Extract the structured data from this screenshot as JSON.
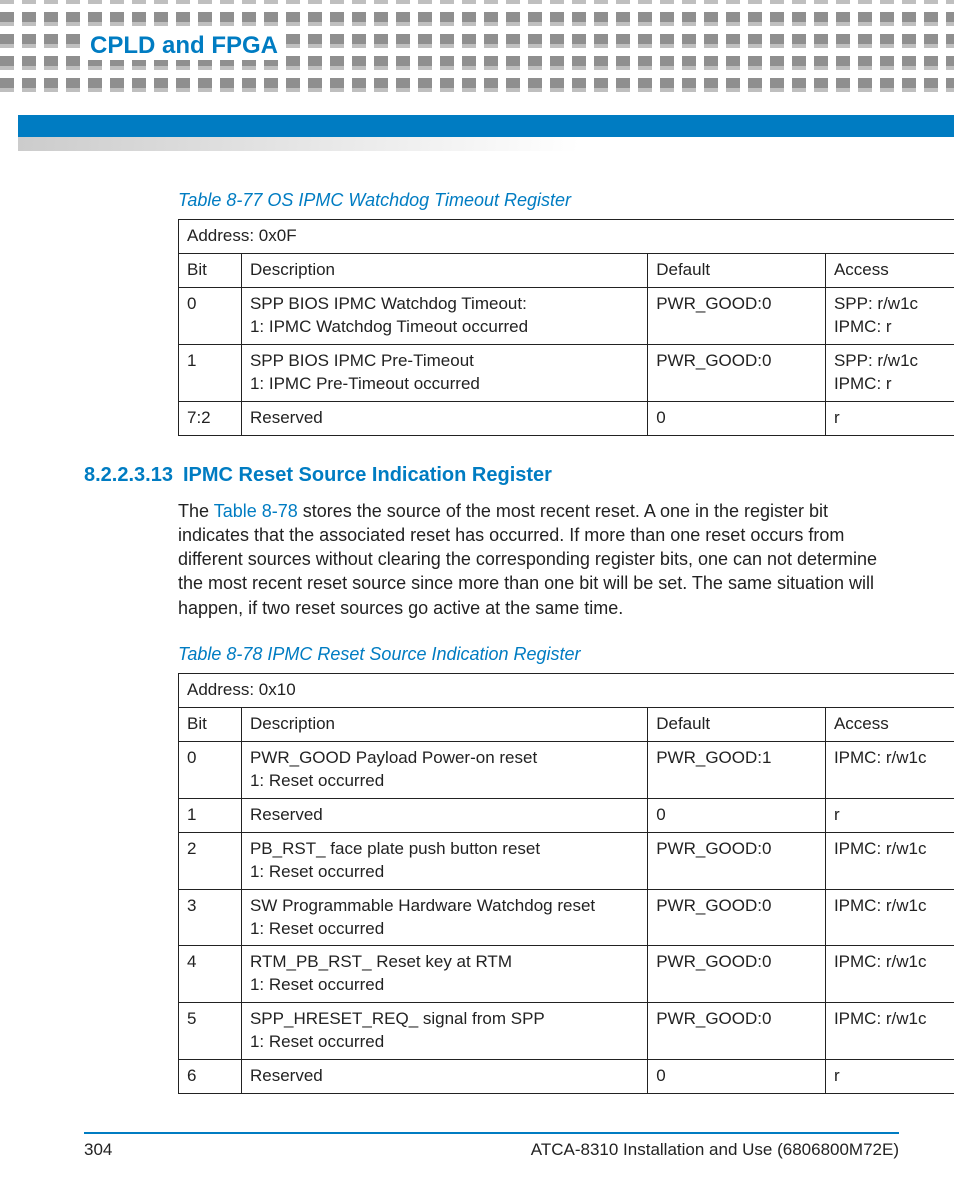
{
  "header": {
    "title": "CPLD and FPGA"
  },
  "table1": {
    "caption": "Table 8-77 OS IPMC Watchdog Timeout Register",
    "address": "Address: 0x0F",
    "cols": {
      "bit": "Bit",
      "desc": "Description",
      "def": "Default",
      "acc": "Access"
    },
    "rows": [
      {
        "bit": "0",
        "desc": "SPP BIOS IPMC Watchdog Timeout:\n1: IPMC Watchdog Timeout occurred",
        "def": "PWR_GOOD:0",
        "acc": "SPP: r/w1c\nIPMC: r"
      },
      {
        "bit": "1",
        "desc": "SPP BIOS IPMC Pre-Timeout\n1: IPMC Pre-Timeout occurred",
        "def": "PWR_GOOD:0",
        "acc": "SPP: r/w1c\nIPMC: r"
      },
      {
        "bit": "7:2",
        "desc": "Reserved",
        "def": "0",
        "acc": "r"
      }
    ]
  },
  "section": {
    "number": "8.2.2.3.13",
    "title": "IPMC Reset Source Indication Register",
    "body_pre": "The ",
    "body_link": "Table 8-78",
    "body_post": " stores the source of the most recent reset. A one in the register bit indicates that the associated reset has occurred. If more than one reset occurs from different sources without clearing the corresponding register bits, one can not determine the most recent reset source since more than one bit will be set. The same situation will happen, if two reset sources go active at the same time."
  },
  "table2": {
    "caption": "Table 8-78 IPMC Reset Source Indication Register",
    "address": "Address: 0x10",
    "cols": {
      "bit": "Bit",
      "desc": "Description",
      "def": "Default",
      "acc": "Access"
    },
    "rows": [
      {
        "bit": "0",
        "desc": "PWR_GOOD Payload Power-on reset\n1: Reset occurred",
        "def": "PWR_GOOD:1",
        "acc": "IPMC: r/w1c"
      },
      {
        "bit": "1",
        "desc": "Reserved",
        "def": "0",
        "acc": "r"
      },
      {
        "bit": "2",
        "desc": "PB_RST_ face plate push button reset\n1: Reset occurred",
        "def": "PWR_GOOD:0",
        "acc": "IPMC: r/w1c"
      },
      {
        "bit": "3",
        "desc": "SW Programmable Hardware Watchdog reset\n1: Reset occurred",
        "def": "PWR_GOOD:0",
        "acc": "IPMC: r/w1c"
      },
      {
        "bit": "4",
        "desc": "RTM_PB_RST_ Reset key at RTM\n1: Reset occurred",
        "def": "PWR_GOOD:0",
        "acc": "IPMC: r/w1c"
      },
      {
        "bit": "5",
        "desc": "SPP_HRESET_REQ_ signal from SPP\n1: Reset occurred",
        "def": "PWR_GOOD:0",
        "acc": "IPMC: r/w1c"
      },
      {
        "bit": "6",
        "desc": "Reserved",
        "def": "0",
        "acc": "r"
      }
    ]
  },
  "footer": {
    "page": "304",
    "docref": "ATCA-8310 Installation and Use (6806800M72E)"
  }
}
